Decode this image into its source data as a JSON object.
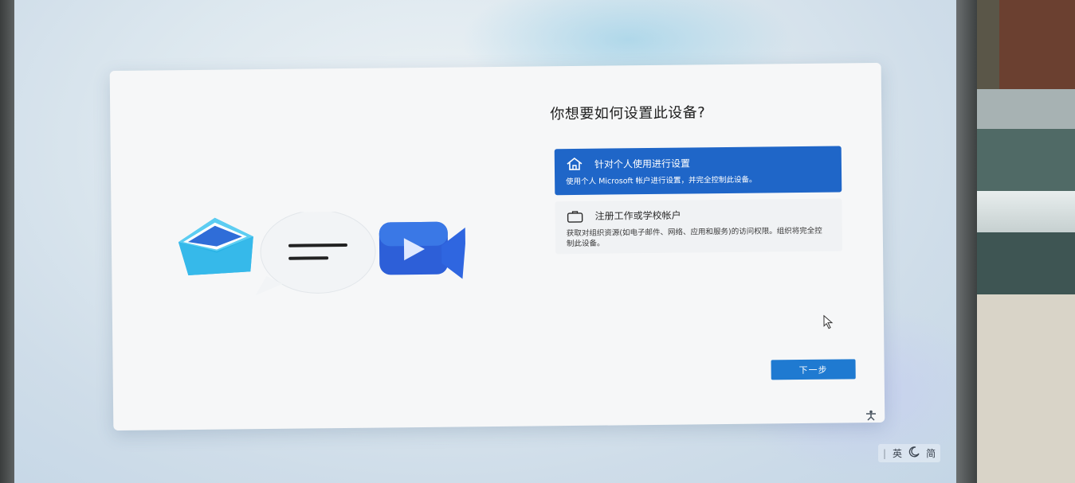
{
  "setup": {
    "title": "你想要如何设置此设备?",
    "options": [
      {
        "icon": "home-icon",
        "label": "针对个人使用进行设置",
        "description": "使用个人 Microsoft 帐户进行设置，并完全控制此设备。",
        "selected": true
      },
      {
        "icon": "briefcase-icon",
        "label": "注册工作或学校帐户",
        "description": "获取对组织资源(如电子邮件、网络、应用和服务)的访问权限。组织将完全控制此设备。",
        "selected": false
      }
    ],
    "next_label": "下一步"
  },
  "tray": {
    "separator": "|",
    "input_mode": "英",
    "moon_icon": "moon-icon",
    "chinese_mode": "简"
  },
  "colors": {
    "accent": "#1f66c8",
    "button": "#1f7ad1",
    "card": "#f6f7f8"
  }
}
